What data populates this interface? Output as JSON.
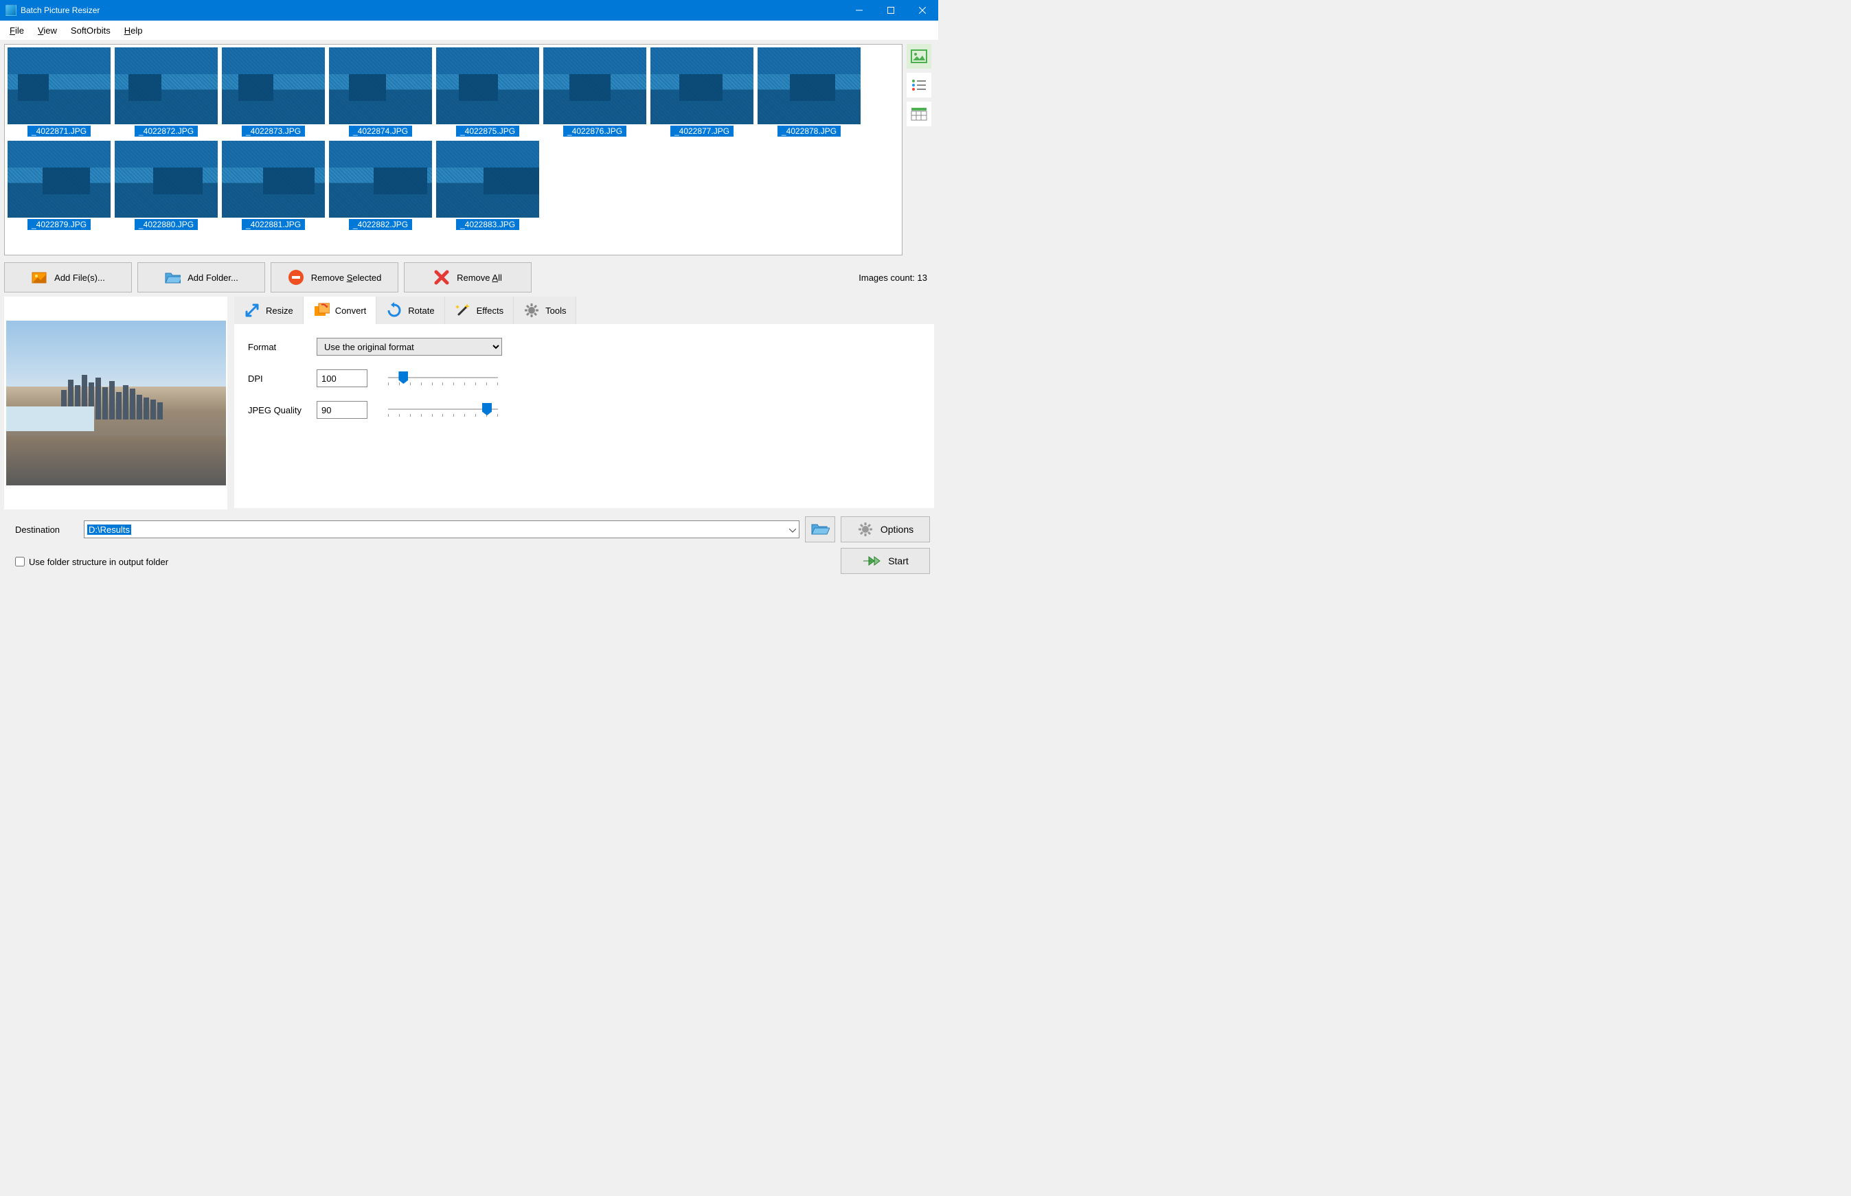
{
  "title": "Batch Picture Resizer",
  "menus": {
    "file": "File",
    "view": "View",
    "softorbits": "SoftOrbits",
    "help": "Help"
  },
  "thumbnails": [
    "_4022871.JPG",
    "_4022872.JPG",
    "_4022873.JPG",
    "_4022874.JPG",
    "_4022875.JPG",
    "_4022876.JPG",
    "_4022877.JPG",
    "_4022878.JPG",
    "_4022879.JPG",
    "_4022880.JPG",
    "_4022881.JPG",
    "_4022882.JPG",
    "_4022883.JPG"
  ],
  "toolbar": {
    "add_files": "Add File(s)...",
    "add_folder": "Add Folder...",
    "remove_selected": "Remove Selected",
    "remove_all": "Remove All",
    "count_label": "Images count: 13"
  },
  "tabs": {
    "resize": "Resize",
    "convert": "Convert",
    "rotate": "Rotate",
    "effects": "Effects",
    "tools": "Tools"
  },
  "convert": {
    "format_label": "Format",
    "format_value": "Use the original format",
    "dpi_label": "DPI",
    "dpi_value": "100",
    "jpeg_label": "JPEG Quality",
    "jpeg_value": "90"
  },
  "destination": {
    "label": "Destination",
    "value": "D:\\Results",
    "use_folder_structure": "Use folder structure in output folder"
  },
  "buttons": {
    "options": "Options",
    "start": "Start"
  }
}
